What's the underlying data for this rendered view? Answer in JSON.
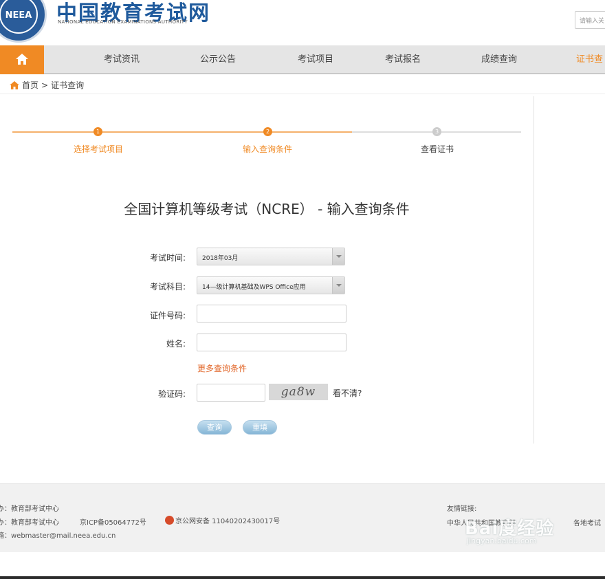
{
  "header": {
    "logo_text": "NEEA",
    "title": "中国教育考试网",
    "subtitle": "NATIONAL EDUCATION EXAMINATIONS AUTHORITY",
    "search_placeholder": "请输入关"
  },
  "nav": {
    "home_icon": "home-icon",
    "items": [
      "考试资讯",
      "公示公告",
      "考试项目",
      "考试报名",
      "成绩查询",
      "证书查"
    ],
    "active_color": "#f08a24"
  },
  "breadcrumb": {
    "home": "首页",
    "separator": ">",
    "current": "证书查询"
  },
  "steps": [
    {
      "num": "1",
      "label": "选择考试项目",
      "state": "done"
    },
    {
      "num": "2",
      "label": "输入查询条件",
      "state": "active"
    },
    {
      "num": "3",
      "label": "查看证书",
      "state": "pending"
    }
  ],
  "form": {
    "title": "全国计算机等级考试（NCRE） - 输入查询条件",
    "exam_time_label": "考试时间:",
    "exam_time_value": "2018年03月",
    "subject_label": "考试科目:",
    "subject_value": "14—级计算机基础及WPS Office应用",
    "id_label": "证件号码:",
    "name_label": "姓名:",
    "more_link": "更多查询条件",
    "captcha_label": "验证码:",
    "captcha_text": "ga8w",
    "captcha_refresh": "看不清?",
    "query_button": "查询",
    "reset_button": "重填"
  },
  "footer": {
    "line1": "主办：教育部考试中心",
    "line2a": "承办：教育部考试中心",
    "line2b": "京ICP备05064772号",
    "police": "京公网安备 11040202430017号",
    "line3": "邮箱：webmaster@mail.neea.edu.cn",
    "links_title": "友情链接:",
    "link1": "中华人民共和国教育部",
    "link2": "各地考试"
  },
  "watermark": {
    "brand": "Bai度经验",
    "url": "jingyan.baidu.com"
  }
}
